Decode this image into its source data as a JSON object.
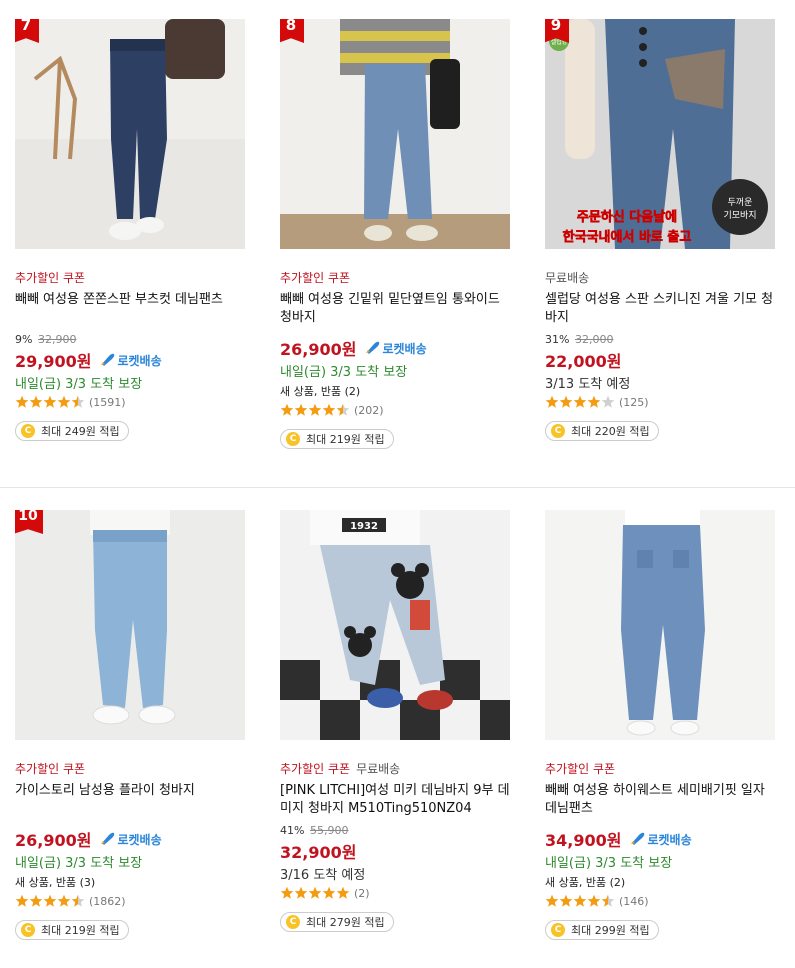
{
  "ui": {
    "rocket_label": "로켓배송",
    "returns_label": "새 상품, 반품",
    "coin_symbol": "C",
    "star_color": "#f39c12",
    "accent_color": "#c1121f"
  },
  "products": [
    {
      "rank": "7",
      "badge_coupon": "추가할인 쿠폰",
      "badge_free": "",
      "title": "빼빼 여성용 쫀쫀스판 부츠컷 데님팬츠",
      "discount_rate": "9%",
      "original_price": "32,900",
      "price": "29,900원",
      "rocket": true,
      "delivery": "내일(금) 3/3 도착 보장",
      "returns_count": "",
      "rating": 4.5,
      "review_count": "(1591)",
      "points": "최대 249원 적립"
    },
    {
      "rank": "8",
      "badge_coupon": "추가할인 쿠폰",
      "badge_free": "",
      "title": "빼빼 여성용 긴밑위 밑단옆트임 통와이드 청바지",
      "discount_rate": "",
      "original_price": "",
      "price": "26,900원",
      "rocket": true,
      "delivery": "내일(금) 3/3 도착 보장",
      "returns_count": "(2)",
      "rating": 4.5,
      "review_count": "(202)",
      "points": "최대 219원 적립"
    },
    {
      "rank": "9",
      "badge_coupon": "",
      "badge_free": "무료배송",
      "title": "셀럽당 여성용 스판 스키니진 겨울 기모 청바지",
      "discount_rate": "31%",
      "original_price": "32,000",
      "price": "22,000원",
      "rocket": false,
      "delivery": "3/13 도착 예정",
      "returns_count": "",
      "rating": 4,
      "review_count": "(125)",
      "points": "최대 220원 적립",
      "image_text": [
        "주문하신 다음날에",
        "한국국내에서 바로 출고",
        "두꺼운",
        "기모바지",
        "셀럽당"
      ]
    },
    {
      "rank": "10",
      "badge_coupon": "추가할인 쿠폰",
      "badge_free": "",
      "title": "가이스토리 남성용 플라이 청바지",
      "discount_rate": "",
      "original_price": "",
      "price": "26,900원",
      "rocket": true,
      "delivery": "내일(금) 3/3 도착 보장",
      "returns_count": "(3)",
      "rating": 4.5,
      "review_count": "(1862)",
      "points": "최대 219원 적립"
    },
    {
      "rank": "",
      "badge_coupon": "추가할인 쿠폰",
      "badge_free": "무료배송",
      "title": "[PINK LITCHI]여성 미키 데님바지 9부 데미지 청바지 M510Ting510NZ04",
      "discount_rate": "41%",
      "original_price": "55,900",
      "price": "32,900원",
      "rocket": false,
      "delivery": "3/16 도착 예정",
      "returns_count": "",
      "rating": 5,
      "review_count": "(2)",
      "points": "최대 279원 적립",
      "image_text": [
        "1932"
      ]
    },
    {
      "rank": "",
      "badge_coupon": "추가할인 쿠폰",
      "badge_free": "",
      "title": "빼빼 여성용 하이웨스트 세미배기핏 일자 데님팬츠",
      "discount_rate": "",
      "original_price": "",
      "price": "34,900원",
      "rocket": true,
      "delivery": "내일(금) 3/3 도착 보장",
      "returns_count": "(2)",
      "rating": 4.5,
      "review_count": "(146)",
      "points": "최대 299원 적립"
    }
  ]
}
